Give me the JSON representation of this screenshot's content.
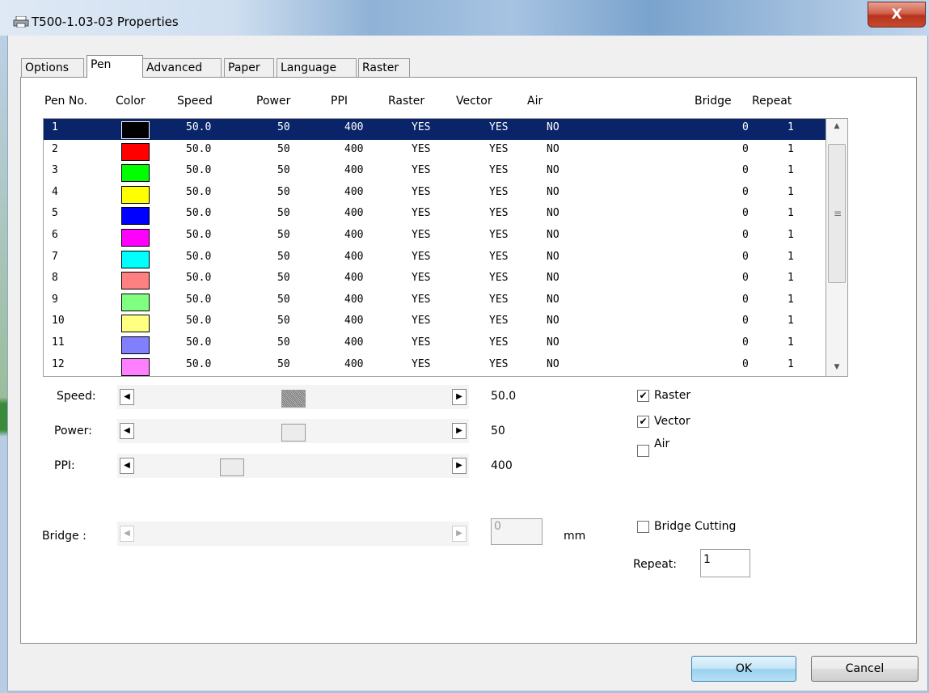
{
  "window": {
    "title": "T500-1.03-03 Properties",
    "close_label": "X"
  },
  "tabs": [
    "Options",
    "Pen",
    "Advanced",
    "Paper",
    "Language",
    "Raster"
  ],
  "active_tab": "Pen",
  "columns": [
    "Pen No.",
    "Color",
    "Speed",
    "Power",
    "PPI",
    "Raster",
    "Vector",
    "Air",
    "Bridge",
    "Repeat"
  ],
  "pens": [
    {
      "no": "1",
      "color": "#000000",
      "speed": "50.0",
      "power": "50",
      "ppi": "400",
      "raster": "YES",
      "vector": "YES",
      "air": "NO",
      "bridge": "0",
      "repeat": "1"
    },
    {
      "no": "2",
      "color": "#ff0000",
      "speed": "50.0",
      "power": "50",
      "ppi": "400",
      "raster": "YES",
      "vector": "YES",
      "air": "NO",
      "bridge": "0",
      "repeat": "1"
    },
    {
      "no": "3",
      "color": "#00ff00",
      "speed": "50.0",
      "power": "50",
      "ppi": "400",
      "raster": "YES",
      "vector": "YES",
      "air": "NO",
      "bridge": "0",
      "repeat": "1"
    },
    {
      "no": "4",
      "color": "#ffff00",
      "speed": "50.0",
      "power": "50",
      "ppi": "400",
      "raster": "YES",
      "vector": "YES",
      "air": "NO",
      "bridge": "0",
      "repeat": "1"
    },
    {
      "no": "5",
      "color": "#0000ff",
      "speed": "50.0",
      "power": "50",
      "ppi": "400",
      "raster": "YES",
      "vector": "YES",
      "air": "NO",
      "bridge": "0",
      "repeat": "1"
    },
    {
      "no": "6",
      "color": "#ff00ff",
      "speed": "50.0",
      "power": "50",
      "ppi": "400",
      "raster": "YES",
      "vector": "YES",
      "air": "NO",
      "bridge": "0",
      "repeat": "1"
    },
    {
      "no": "7",
      "color": "#00ffff",
      "speed": "50.0",
      "power": "50",
      "ppi": "400",
      "raster": "YES",
      "vector": "YES",
      "air": "NO",
      "bridge": "0",
      "repeat": "1"
    },
    {
      "no": "8",
      "color": "#ff8080",
      "speed": "50.0",
      "power": "50",
      "ppi": "400",
      "raster": "YES",
      "vector": "YES",
      "air": "NO",
      "bridge": "0",
      "repeat": "1"
    },
    {
      "no": "9",
      "color": "#80ff80",
      "speed": "50.0",
      "power": "50",
      "ppi": "400",
      "raster": "YES",
      "vector": "YES",
      "air": "NO",
      "bridge": "0",
      "repeat": "1"
    },
    {
      "no": "10",
      "color": "#ffff80",
      "speed": "50.0",
      "power": "50",
      "ppi": "400",
      "raster": "YES",
      "vector": "YES",
      "air": "NO",
      "bridge": "0",
      "repeat": "1"
    },
    {
      "no": "11",
      "color": "#8080ff",
      "speed": "50.0",
      "power": "50",
      "ppi": "400",
      "raster": "YES",
      "vector": "YES",
      "air": "NO",
      "bridge": "0",
      "repeat": "1"
    },
    {
      "no": "12",
      "color": "#ff80ff",
      "speed": "50.0",
      "power": "50",
      "ppi": "400",
      "raster": "YES",
      "vector": "YES",
      "air": "NO",
      "bridge": "0",
      "repeat": "1"
    }
  ],
  "selected_pen_index": 0,
  "controls": {
    "speed": {
      "label": "Speed:",
      "value": "50.0",
      "level": 0.5
    },
    "power": {
      "label": "Power:",
      "value": "50",
      "level": 0.5
    },
    "ppi": {
      "label": "PPI:",
      "value": "400",
      "level": 0.29
    },
    "bridge": {
      "label": "Bridge :",
      "value": "0",
      "unit": "mm",
      "level": 0
    }
  },
  "checkboxes": {
    "raster": {
      "label": "Raster",
      "checked": true
    },
    "vector": {
      "label": "Vector",
      "checked": true
    },
    "air": {
      "label": "Air",
      "checked": false
    },
    "bridge_cutting": {
      "label": "Bridge Cutting",
      "checked": false
    }
  },
  "repeat": {
    "label": "Repeat:",
    "value": "1"
  },
  "buttons": {
    "ok": "OK",
    "cancel": "Cancel"
  },
  "colors": {
    "selection": "#0a246a"
  }
}
